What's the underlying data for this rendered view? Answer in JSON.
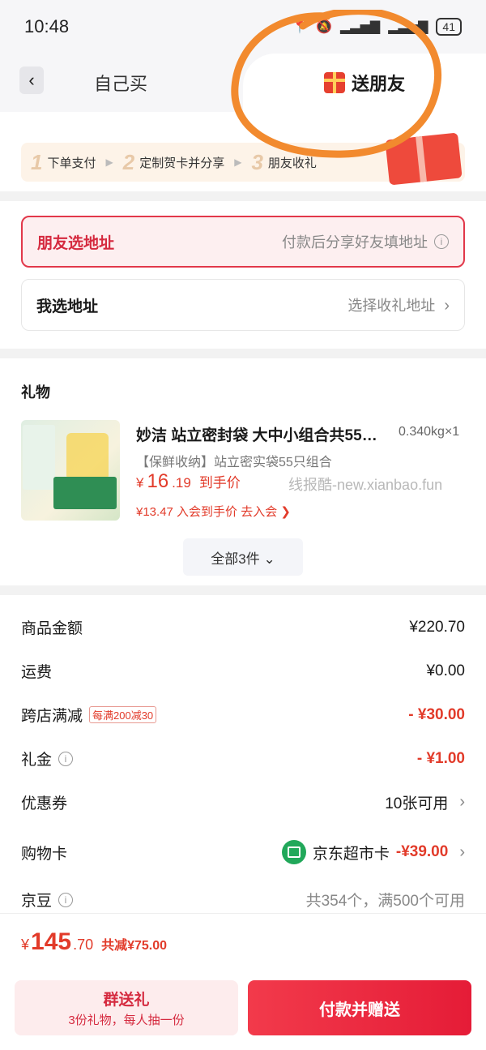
{
  "status_bar": {
    "time": "10:48",
    "battery": "41"
  },
  "nav": {
    "tab_self": "自己买",
    "tab_gift": "送朋友"
  },
  "steps": [
    {
      "num": "1",
      "label": "下单支付"
    },
    {
      "num": "2",
      "label": "定制贺卡并分享"
    },
    {
      "num": "3",
      "label": "朋友收礼"
    }
  ],
  "address": {
    "friend_label": "朋友选地址",
    "friend_hint": "付款后分享好友填地址",
    "self_label": "我选地址",
    "self_hint": "选择收礼地址"
  },
  "gift": {
    "section_title": "礼物",
    "name": "妙洁 站立密封袋 大中小组合共55…",
    "qty": "0.340kg×1",
    "spec": "【保鲜收纳】站立密实袋55只组合",
    "price_symbol": "¥",
    "price_int": "16",
    "price_dec": ".19",
    "price_suffix": "到手价",
    "member_price": "¥13.47 入会到手价 去入会 ❯",
    "watermark": "线报酷-new.xianbao.fun",
    "all_button": "全部3件 ⌄"
  },
  "amounts": {
    "goods_label": "商品金额",
    "goods_value": "¥220.70",
    "shipping_label": "运费",
    "shipping_value": "¥0.00",
    "cross_label": "跨店满减",
    "cross_badge": "每满200减30",
    "cross_value": "- ¥30.00",
    "cash_label": "礼金",
    "cash_value": "- ¥1.00",
    "coupon_label": "优惠券",
    "coupon_value": "10张可用",
    "card_label": "购物卡",
    "card_name": "京东超市卡",
    "card_value": "-¥39.00",
    "bean_label": "京豆",
    "bean_value": "共354个，满500个可用"
  },
  "footer": {
    "currency": "¥",
    "total_int": "145",
    "total_dec": ".70",
    "discount": "共减¥75.00",
    "group_title": "群送礼",
    "group_sub": "3份礼物，每人抽一份",
    "pay_label": "付款并赠送"
  },
  "colors": {
    "accent_red": "#e23b2a",
    "brand_red": "#e51c37",
    "annotation": "#f28a2e"
  }
}
